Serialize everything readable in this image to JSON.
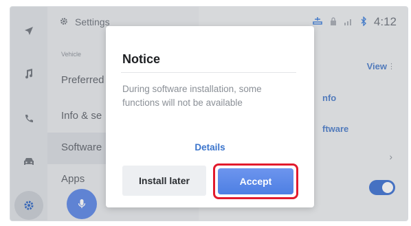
{
  "settings": {
    "header_title": "Settings",
    "section_label": "Vehicle",
    "items": [
      "Preferred",
      "Info & se",
      "Software",
      "Apps"
    ]
  },
  "right_panel": {
    "view_label": "View",
    "info_label": "nfo",
    "software_label": "ftware",
    "chevron": "›"
  },
  "status_bar": {
    "time": "4:12"
  },
  "dialog": {
    "title": "Notice",
    "message": "During software installation, some functions will not be available",
    "details_label": "Details",
    "install_later_label": "Install later",
    "accept_label": "Accept"
  },
  "colors": {
    "accent": "#4d7fe3",
    "highlight_ring": "#e21a2d",
    "toggle_on": "#3a6fd1"
  }
}
